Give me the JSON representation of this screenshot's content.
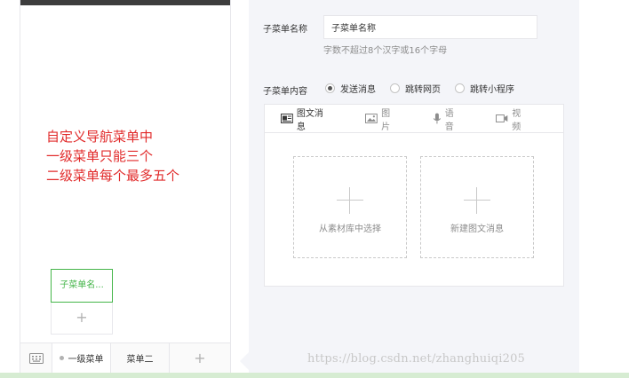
{
  "annotation": {
    "lines": [
      "自定义导航菜单中",
      "一级菜单只能三个",
      "二级菜单每个最多五个"
    ]
  },
  "preview": {
    "sub_menu_item": "子菜单名...",
    "sub_menu_add": "+",
    "bottom_menus": [
      "一级菜单",
      "菜单二"
    ],
    "bottom_add": "+"
  },
  "editor": {
    "name_label": "子菜单名称",
    "name_value": "子菜单名称",
    "name_hint": "字数不超过8个汉字或16个字母",
    "content_label": "子菜单内容",
    "content_options": [
      {
        "label": "发送消息",
        "selected": true
      },
      {
        "label": "跳转网页",
        "selected": false
      },
      {
        "label": "跳转小程序",
        "selected": false
      }
    ],
    "tabs": [
      "图文消息",
      "图片",
      "语音",
      "视频"
    ],
    "cards": [
      "从素材库中选择",
      "新建图文消息"
    ]
  },
  "watermark": "https://blog.csdn.net/zhanghuiqi205",
  "colors": {
    "accent": "#44b549",
    "annotation": "#e12a2a",
    "panel_bg": "#f4f5f9",
    "border": "#e7e7eb"
  }
}
